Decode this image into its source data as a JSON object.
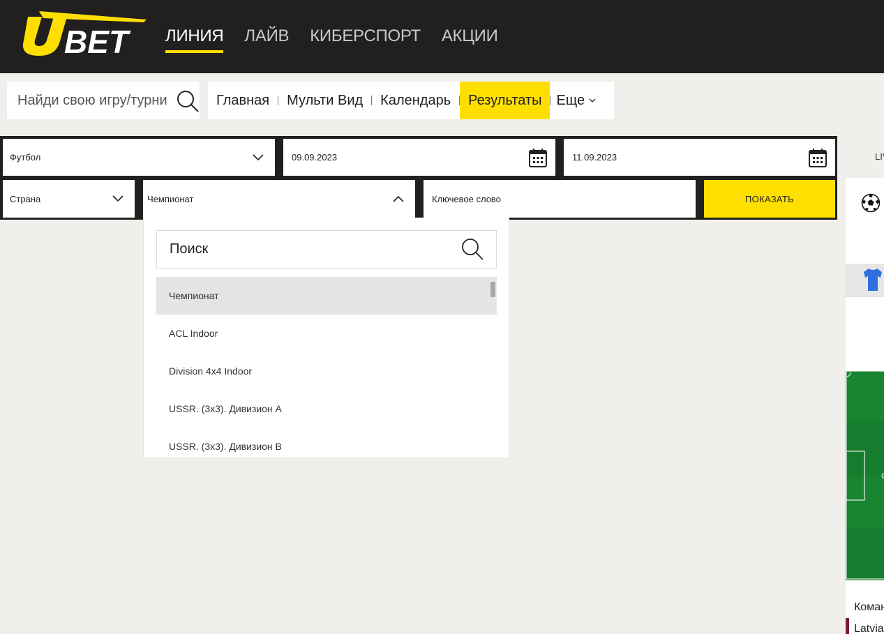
{
  "header": {
    "logo_text": "UBET",
    "nav": [
      {
        "label": "ЛИНИЯ",
        "active": true
      },
      {
        "label": "ЛАЙВ",
        "active": false
      },
      {
        "label": "КИБЕРСПОРТ",
        "active": false
      },
      {
        "label": "АКЦИИ",
        "active": false
      }
    ]
  },
  "search": {
    "placeholder": "Найди свою игру/турнир"
  },
  "submenu": {
    "items": [
      "Главная",
      "Мульти Вид",
      "Календарь",
      "Результаты"
    ],
    "active": "Результаты",
    "more_label": "Еще"
  },
  "filters": {
    "sport": "Футбол",
    "date_from": "09.09.2023",
    "date_to": "11.09.2023",
    "country": "Страна",
    "championship": "Чемпионат",
    "keyword_placeholder": "Ключевое слово",
    "show_button": "ПОКАЗАТЬ"
  },
  "dropdown": {
    "search_placeholder": "Поиск",
    "items": [
      "Чемпионат",
      "ACL Indoor",
      "Division 4x4 Indoor",
      "USSR. (3x3). Дивизион А",
      "USSR. (3x3). Дивизион В"
    ],
    "selected": "Чемпионат"
  },
  "right_panel": {
    "tab_label": "LIVE",
    "team_label": "Команда",
    "latvia_label": "Latvia"
  },
  "colors": {
    "header_bg": "#221f1f",
    "accent": "#ffdf00",
    "pitch": "#177c2d"
  }
}
